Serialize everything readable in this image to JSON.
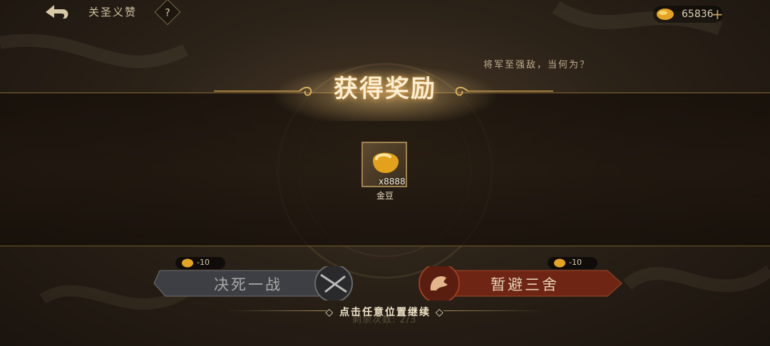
{
  "header": {
    "title": "关圣义赞",
    "help_label": "?",
    "currency_amount": "65836",
    "plus_label": "+"
  },
  "background": {
    "quote": "将军至强敌，当何为？"
  },
  "reward": {
    "title": "获得奖励",
    "item": {
      "name": "金豆",
      "count": "x8888",
      "icon": "gold-bean-icon"
    }
  },
  "choices": [
    {
      "label": "决死一战",
      "cost": "-10"
    },
    {
      "label": "暂避三舍",
      "cost": "-10"
    }
  ],
  "footer": {
    "continue_text": "点击任意位置继续",
    "remaining": "剩余次数: 2/3"
  },
  "colors": {
    "gold": "#e0b04a",
    "band_border": "#cda050",
    "retreat_red": "#8a2b18"
  }
}
